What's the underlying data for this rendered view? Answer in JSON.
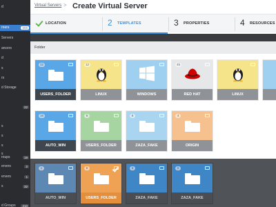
{
  "sidebar": {
    "items": [
      {
        "label": "d",
        "badge": "",
        "active": false
      },
      {
        "label": "rners",
        "badge": "559",
        "active": true
      },
      {
        "label": "Servers",
        "badge": "",
        "active": false
      },
      {
        "label": "ancers",
        "badge": "",
        "active": false
      },
      {
        "label": "d",
        "badge": "",
        "active": false
      },
      {
        "label": "s",
        "badge": "",
        "active": false
      },
      {
        "label": "rs",
        "badge": "",
        "active": false
      },
      {
        "label": "d Storage",
        "badge": "",
        "active": false
      },
      {
        "label": "",
        "badge": "22",
        "active": false
      },
      {
        "label": "",
        "badge": "",
        "active": false
      },
      {
        "label": "s",
        "badge": "",
        "active": false
      },
      {
        "label": "s",
        "badge": "",
        "active": false
      },
      {
        "label": "s",
        "badge": "",
        "active": false
      },
      {
        "label": "s",
        "badge": "",
        "active": false
      },
      {
        "label": "roups",
        "badge": "19",
        "active": false
      },
      {
        "label": "ervers",
        "badge": "2",
        "active": false
      },
      {
        "label": "ervers",
        "badge": "1",
        "active": false
      },
      {
        "label": "s",
        "badge": "32",
        "active": false
      },
      {
        "label": "d Groups",
        "badge": "210",
        "active": false
      }
    ]
  },
  "header": {
    "breadcrumb": "Virtual Servers",
    "separator": ">",
    "title": "Create Virtual Server"
  },
  "steps": [
    {
      "num": "",
      "label": "LOCATION",
      "done": true,
      "current": false
    },
    {
      "num": "2",
      "label": "TEMPLATES",
      "done": false,
      "current": true
    },
    {
      "num": "3",
      "label": "PROPERTIES",
      "done": false,
      "current": false
    },
    {
      "num": "4",
      "label": "RESOURCES",
      "done": false,
      "current": false
    }
  ],
  "progress": 0.56,
  "panel": {
    "title": "Folder"
  },
  "templates_row1": [
    {
      "label": "USERS_FOLDER",
      "count": "32",
      "icon": "folder-icon",
      "color": "#5aa7e8",
      "bot": "#3f464d",
      "highlight": true
    },
    {
      "label": "LINUX",
      "count": "12",
      "icon": "tux-icon",
      "color": "#f6e48a",
      "bot": "#8f9296",
      "highlight": false
    },
    {
      "label": "WINDOWS",
      "count": "",
      "icon": "windows-icon",
      "color": "#9fd0ef",
      "bot": "#8f9296",
      "highlight": false
    },
    {
      "label": "RED HAT",
      "count": "45",
      "icon": "redhat-icon",
      "color": "#e6e7e8",
      "bot": "#8f9296",
      "highlight": false
    },
    {
      "label": "LINUX",
      "count": "",
      "icon": "tux-icon",
      "color": "#f6e48a",
      "bot": "#8f9296",
      "highlight": false
    },
    {
      "label": "SLA",
      "count": "",
      "icon": "sla-icon",
      "color": "#9fd0ef",
      "bot": "#8f9296",
      "highlight": false
    }
  ],
  "templates_row2": [
    {
      "label": "AUTO_WIN",
      "count": "16",
      "icon": "folder-icon",
      "color": "#5aa7e8",
      "bot": "#3f464d",
      "highlight": true
    },
    {
      "label": "USERS_FOLDER",
      "count": "6",
      "icon": "folder-icon",
      "color": "#a6d5a2",
      "bot": "#8f9296",
      "highlight": false
    },
    {
      "label": "ZAZA_FAKE",
      "count": "6",
      "icon": "folder-icon",
      "color": "#a9d5f0",
      "bot": "#8f9296",
      "highlight": false
    },
    {
      "label": "ORIGIN",
      "count": "4",
      "icon": "folder-icon",
      "color": "#f7c18f",
      "bot": "#8f9296",
      "highlight": false
    }
  ],
  "tray": [
    {
      "label": "AUTO_WIN",
      "count": "1",
      "icon": "folder-icon",
      "color": "#5c88b3",
      "selected": false
    },
    {
      "label": "USERS_FOLDER",
      "count": "6",
      "icon": "folder-icon",
      "color": "#f0a254",
      "selected": true
    },
    {
      "label": "ZAZA_FAKE",
      "count": "6",
      "icon": "folder-icon",
      "color": "#3f86c7",
      "selected": false
    },
    {
      "label": "ZAZA_FAKE",
      "count": "6",
      "icon": "folder-icon",
      "color": "#3f86c7",
      "selected": false
    }
  ]
}
